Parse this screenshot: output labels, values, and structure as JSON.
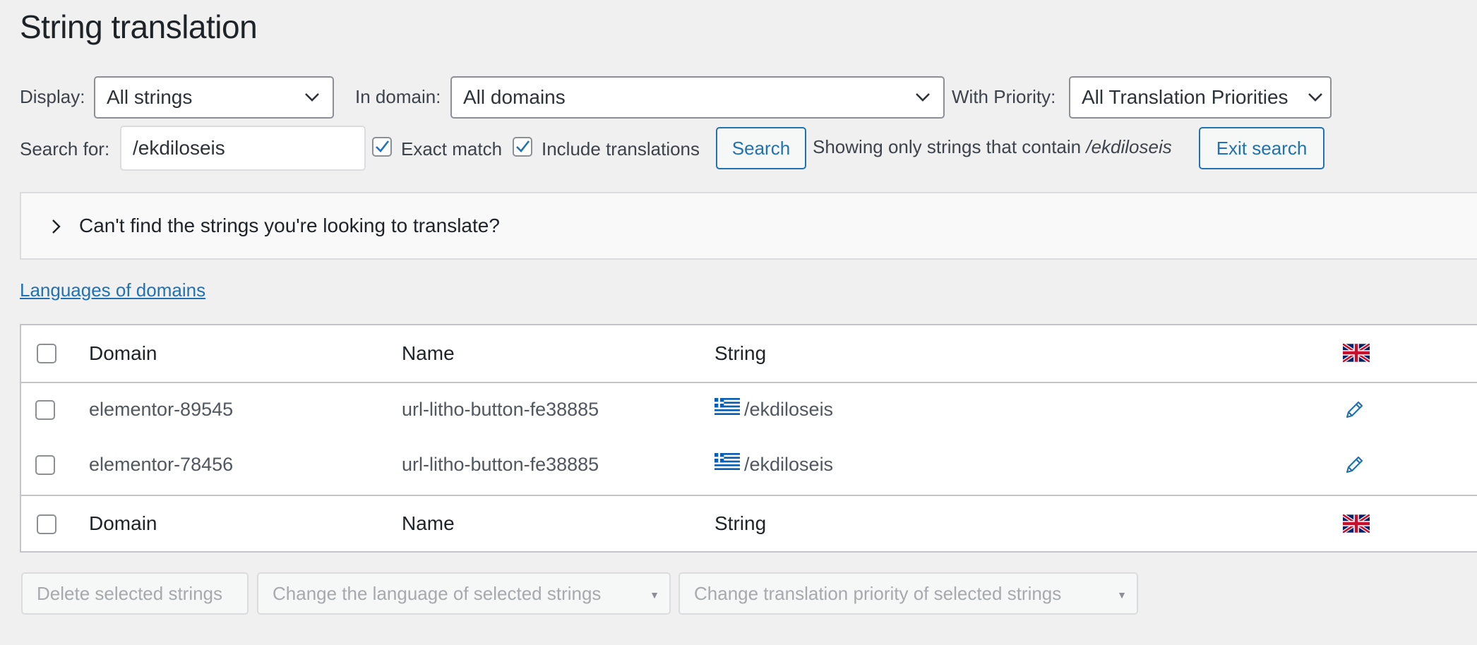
{
  "page": {
    "title": "String translation"
  },
  "filters": {
    "display_label": "Display:",
    "display_value": "All strings",
    "domain_label": "In domain:",
    "domain_value": "All domains",
    "priority_label": "With Priority:",
    "priority_value": "All Translation Priorities"
  },
  "search": {
    "label": "Search for:",
    "value": "/ekdiloseis",
    "exact_match_label": "Exact match",
    "exact_match_checked": true,
    "include_translations_label": "Include translations",
    "include_translations_checked": true,
    "search_button": "Search",
    "showing_text": "Showing only strings that contain",
    "showing_term": "/ekdiloseis",
    "exit_button": "Exit search"
  },
  "info_box": {
    "text": "Can't find the strings you're looking to translate?"
  },
  "languages_link": "Languages of domains",
  "table": {
    "columns": [
      "Domain",
      "Name",
      "String"
    ],
    "header_flag": "uk-flag-icon",
    "rows": [
      {
        "domain": "elementor-89545",
        "name": "url-litho-button-fe38885",
        "string": "/ekdiloseis",
        "string_flag": "greek-flag-icon"
      },
      {
        "domain": "elementor-78456",
        "name": "url-litho-button-fe38885",
        "string": "/ekdiloseis",
        "string_flag": "greek-flag-icon"
      }
    ]
  },
  "bulk_actions": {
    "delete": "Delete selected strings",
    "change_language": "Change the language of selected strings",
    "change_priority": "Change translation priority of selected strings"
  },
  "colors": {
    "accent": "#2271b1",
    "background": "#f0f0f1",
    "disabled_text": "#a7aaad"
  }
}
